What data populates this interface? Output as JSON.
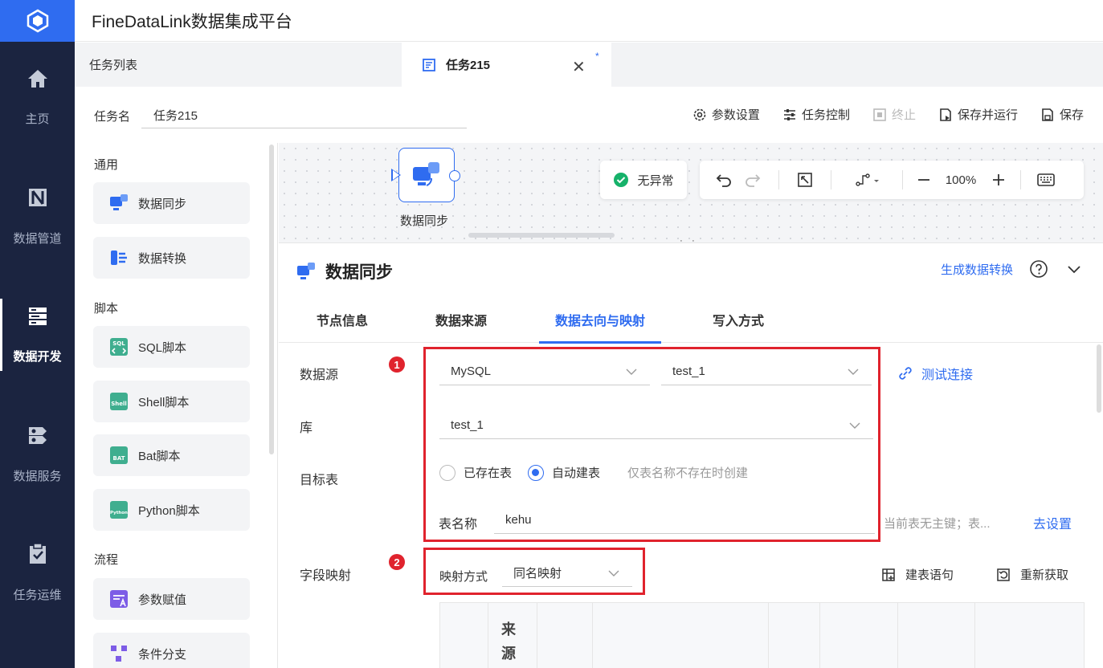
{
  "app": {
    "title": "FineDataLink数据集成平台"
  },
  "nav": {
    "items": [
      {
        "label": "主页",
        "icon": "home-icon"
      },
      {
        "label": "数据管道",
        "icon": "pipeline-icon"
      },
      {
        "label": "数据开发",
        "icon": "dev-icon",
        "active": true
      },
      {
        "label": "数据服务",
        "icon": "service-icon"
      },
      {
        "label": "任务运维",
        "icon": "ops-icon"
      }
    ]
  },
  "tabs": {
    "list_label": "任务列表",
    "active_label": "任务215",
    "close_glyph": "✕",
    "dirty_mark": "*"
  },
  "task": {
    "name_label": "任务名",
    "name_value": "任务215"
  },
  "toolbar": {
    "params": "参数设置",
    "control": "任务控制",
    "stop": "终止",
    "save_run": "保存并运行",
    "save": "保存"
  },
  "palette": {
    "sections": {
      "general": "通用",
      "script": "脚本",
      "flow": "流程"
    },
    "general_items": [
      "数据同步",
      "数据转换"
    ],
    "script_items": [
      "SQL脚本",
      "Shell脚本",
      "Bat脚本",
      "Python脚本"
    ],
    "flow_items": [
      "参数赋值",
      "条件分支"
    ],
    "script_icon_text": {
      "sql": "SQL",
      "shell": "Shell",
      "bat": "BAT",
      "python": "Python"
    }
  },
  "canvas": {
    "node_label": "数据同步",
    "status": "无异常",
    "zoom": "100%",
    "drag_handle": "⋮⋮"
  },
  "panel": {
    "title": "数据同步",
    "generate_link": "生成数据转换",
    "tabs": [
      "节点信息",
      "数据来源",
      "数据去向与映射",
      "写入方式"
    ],
    "active_tab_index": 2,
    "labels": {
      "datasource": "数据源",
      "database": "库",
      "target_table": "目标表",
      "field_mapping": "字段映射"
    },
    "datasource": {
      "type": "MySQL",
      "connection": "test_1",
      "test_link": "测试连接"
    },
    "database": {
      "value": "test_1"
    },
    "target": {
      "existing": "已存在表",
      "auto_create": "自动建表",
      "selected": "auto_create",
      "hint": "仅表名称不存在时创建",
      "table_name_label": "表名称",
      "table_name_value": "kehu",
      "pk_hint": "当前表无主键；表...",
      "pk_link": "去设置"
    },
    "mapping": {
      "method_label": "映射方式",
      "method_value": "同名映射",
      "create_stmt": "建表语句",
      "refetch": "重新获取",
      "table_header_partial": "来源"
    },
    "badges": [
      "1",
      "2"
    ]
  },
  "colors": {
    "accent": "#2f6cf0",
    "nav_bg": "#1b2440",
    "highlight_red": "#e0232d",
    "status_green": "#16b26a"
  }
}
